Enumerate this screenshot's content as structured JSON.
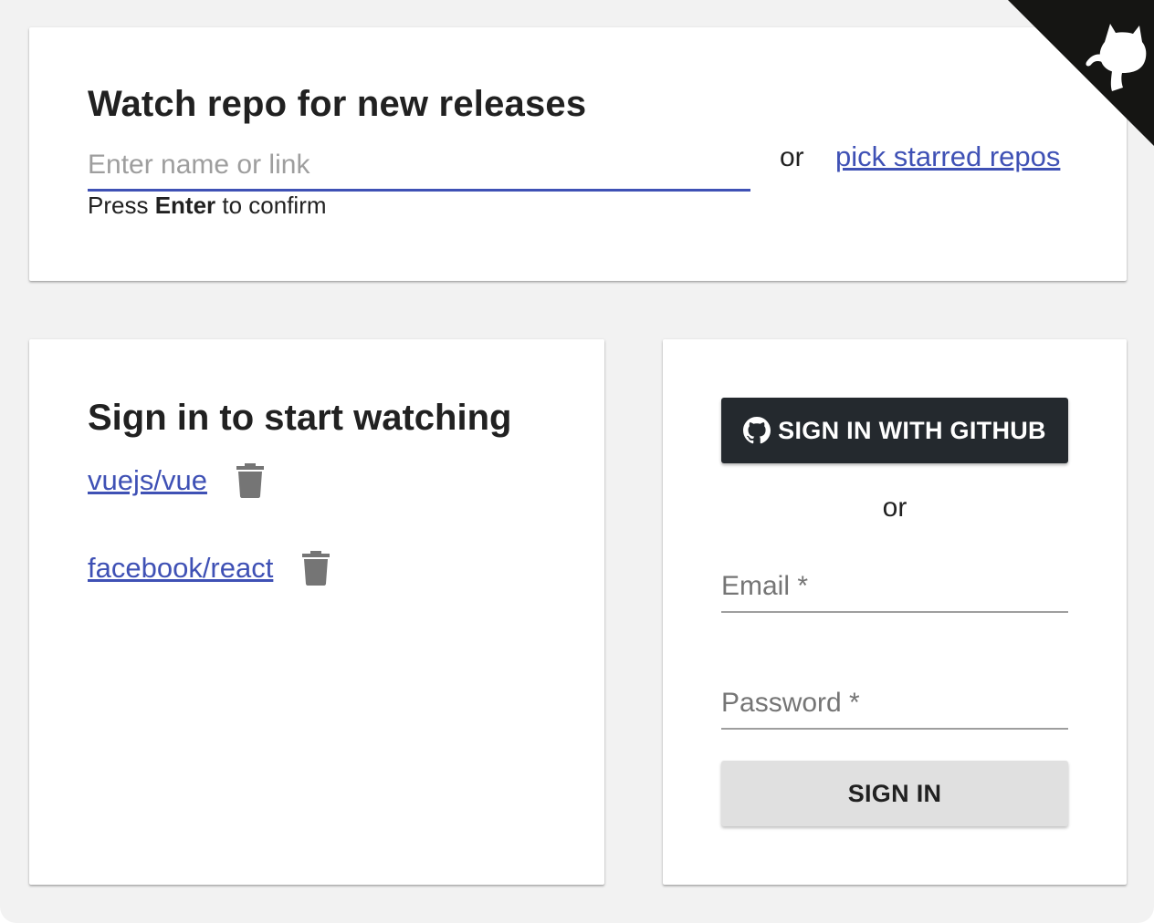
{
  "corner": {
    "icon": "github-octocat-icon",
    "bg_color": "#151513",
    "fg_color": "#ffffff"
  },
  "watch": {
    "title": "Watch repo for new releases",
    "input_placeholder": "Enter name or link",
    "input_value": "",
    "hint_prefix": "Press ",
    "hint_key": "Enter",
    "hint_suffix": " to confirm",
    "or": "or",
    "starred_link": "pick starred repos",
    "accent_color": "#3f51b5"
  },
  "list": {
    "title": "Sign in to start watching",
    "repos": [
      {
        "name": "vuejs/vue",
        "delete_icon": "trash-icon"
      },
      {
        "name": "facebook/react",
        "delete_icon": "trash-icon"
      }
    ]
  },
  "auth": {
    "github_button": "SIGN IN WITH GITHUB",
    "github_icon": "github-icon",
    "or": "or",
    "email_placeholder": "Email *",
    "password_placeholder": "Password *",
    "signin_button": "SIGN IN"
  }
}
